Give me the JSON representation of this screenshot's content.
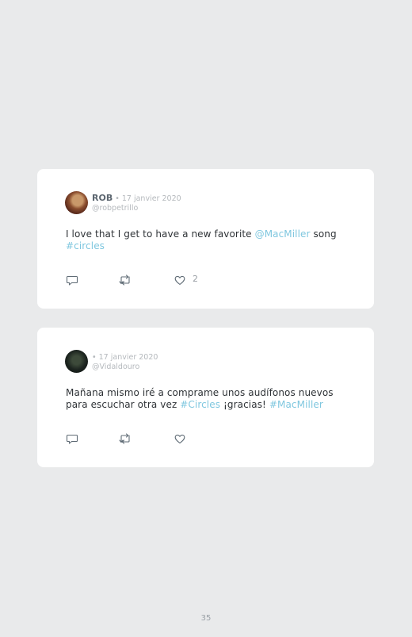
{
  "tweets": [
    {
      "name": "ROB",
      "date": " • 17 janvier 2020",
      "handle": "@robpetrillo",
      "text_parts": [
        "I love that I get to have a new favorite ",
        "@MacMiller",
        " song",
        "#circles"
      ],
      "likes": "2"
    },
    {
      "name": "",
      "date": "• 17 janvier 2020",
      "handle": "@Vidaldouro",
      "text_parts": [
        "Mañana mismo iré a comprame unos audífonos nuevos para escuchar otra vez ",
        "#Circles",
        " ¡gracias! ",
        "#MacMiller"
      ],
      "likes": ""
    }
  ],
  "icons": {
    "reply": "reply-icon",
    "retweet": "retweet-icon",
    "like": "heart-icon"
  },
  "colors": {
    "link": "#7fc7df",
    "background": "#e9eaeb",
    "card": "#ffffff"
  },
  "page": {
    "number": "35"
  }
}
